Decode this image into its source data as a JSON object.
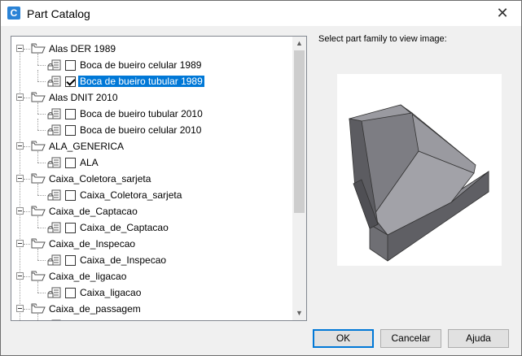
{
  "window": {
    "title": "Part Catalog",
    "icon_letter": "C",
    "close_glyph": "✕"
  },
  "preview": {
    "label": "Select part family to view image:"
  },
  "tree": {
    "items": [
      {
        "kind": "group",
        "label": "Alas DER 1989"
      },
      {
        "kind": "part",
        "label": "Boca de bueiro celular 1989",
        "checked": false,
        "selected": false
      },
      {
        "kind": "part",
        "label": "Boca de bueiro tubular 1989",
        "checked": true,
        "selected": true
      },
      {
        "kind": "group",
        "label": "Alas DNIT 2010"
      },
      {
        "kind": "part",
        "label": "Boca de bueiro tubular 2010",
        "checked": false,
        "selected": false
      },
      {
        "kind": "part",
        "label": "Boca de bueiro celular 2010",
        "checked": false,
        "selected": false
      },
      {
        "kind": "group",
        "label": "ALA_GENERICA"
      },
      {
        "kind": "part",
        "label": "ALA",
        "checked": false,
        "selected": false
      },
      {
        "kind": "group",
        "label": "Caixa_Coletora_sarjeta"
      },
      {
        "kind": "part",
        "label": "Caixa_Coletora_sarjeta",
        "checked": false,
        "selected": false
      },
      {
        "kind": "group",
        "label": "Caixa_de_Captacao"
      },
      {
        "kind": "part",
        "label": "Caixa_de_Captacao",
        "checked": false,
        "selected": false
      },
      {
        "kind": "group",
        "label": "Caixa_de_Inspecao"
      },
      {
        "kind": "part",
        "label": "Caixa_de_Inspecao",
        "checked": false,
        "selected": false
      },
      {
        "kind": "group",
        "label": "Caixa_de_ligacao"
      },
      {
        "kind": "part",
        "label": "Caixa_ligacao",
        "checked": false,
        "selected": false
      },
      {
        "kind": "group",
        "label": "Caixa_de_passagem"
      },
      {
        "kind": "part",
        "label": "Caixa_passagem",
        "checked": false,
        "selected": false
      }
    ]
  },
  "buttons": {
    "ok": "OK",
    "cancel": "Cancelar",
    "help": "Ajuda"
  },
  "colors": {
    "selection": "#0078d7",
    "shape_face": "#7b7b80",
    "shape_dark": "#55555a",
    "shape_light": "#9a9aa0"
  }
}
